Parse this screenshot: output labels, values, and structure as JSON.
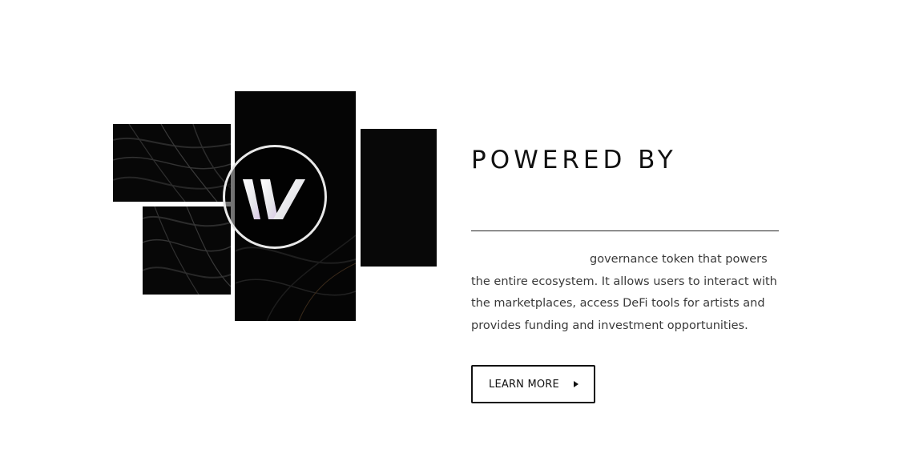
{
  "collage": {
    "logo_icon": "w-logo-icon"
  },
  "section": {
    "heading": "POWERED BY",
    "body_lines": [
      "governance token that powers",
      "the entire ecosystem. It allows users to interact with",
      "the marketplaces, access DeFi tools for artists and",
      "provides funding and investment opportunities."
    ],
    "button_label": "LEARN MORE",
    "button_icon": "play-arrow-icon"
  },
  "colors": {
    "text": "#111111",
    "body_text": "#3a3a3a",
    "panel": "#070707",
    "ring": "#e8e8e8"
  }
}
